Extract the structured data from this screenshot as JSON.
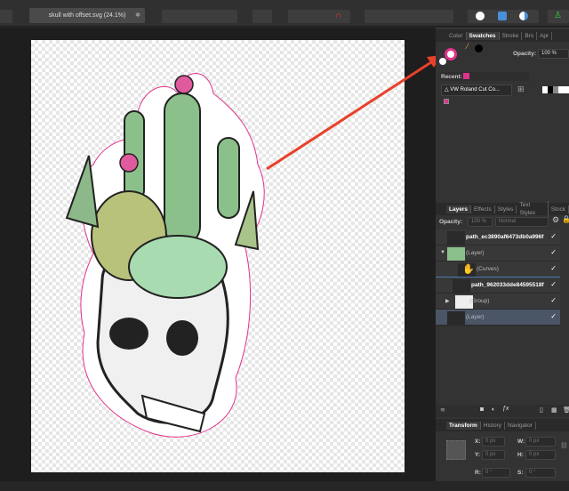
{
  "document": {
    "tab_title": "skull with offset.svg (24.1%)"
  },
  "color_panel": {
    "tabs": [
      "Color",
      "Swatches",
      "Stroke",
      "Brs",
      "Apr"
    ],
    "active_tab": "Swatches",
    "opacity_label": "Opacity:",
    "opacity_value": "100 %",
    "recent_label": "Recent:",
    "palette_name": "VW Roland Cut Co...",
    "recent_color": "#e0338c"
  },
  "layers_panel": {
    "tabs": [
      "Layers",
      "Effects",
      "Styles",
      "Text Styles",
      "Stock"
    ],
    "active_tab": "Layers",
    "opacity_label": "Opacity:",
    "opacity_value": "100 %",
    "blend_mode": "Normal",
    "layers": [
      {
        "name": "path_ec3890af6473db0a996f",
        "check": "✓"
      },
      {
        "name": "(Layer)",
        "check": "✓"
      },
      {
        "name": "(Curves)",
        "check": "✓"
      },
      {
        "name": "path_962033dde84595518f",
        "check": "✓"
      },
      {
        "name": "(Group)",
        "check": "✓"
      },
      {
        "name": "(Layer)",
        "check": "✓"
      }
    ]
  },
  "transform_panel": {
    "tabs": [
      "Transform",
      "History",
      "Navigator"
    ],
    "active_tab": "Transform",
    "x_label": "X:",
    "x": "0 px",
    "y_label": "Y:",
    "y": "0 px",
    "w_label": "W:",
    "w": "0 px",
    "h_label": "H:",
    "h": "0 px",
    "r_label": "R:",
    "r": "0 °",
    "s_label": "S:",
    "s": "0 °"
  },
  "colors": {
    "accent": "#e0338c",
    "arrow": "#e8402a",
    "selection": "#4a5566"
  }
}
